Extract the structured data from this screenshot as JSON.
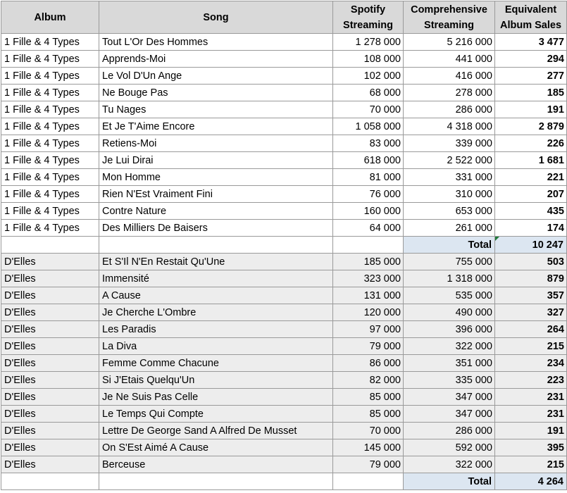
{
  "headers": {
    "album": "Album",
    "song": "Song",
    "spotify": [
      "Spotify",
      "Streaming"
    ],
    "comprehensive": [
      "Comprehensive",
      "Streaming"
    ],
    "equivalent": [
      "Equivalent",
      "Album Sales"
    ]
  },
  "groups": [
    {
      "rows": [
        {
          "album": "1 Fille & 4 Types",
          "song": "Tout L'Or Des Hommes",
          "spotify": "1 278 000",
          "comprehensive": "5 216 000",
          "eas": "3 477"
        },
        {
          "album": "1 Fille & 4 Types",
          "song": "Apprends-Moi",
          "spotify": "108 000",
          "comprehensive": "441 000",
          "eas": "294"
        },
        {
          "album": "1 Fille & 4 Types",
          "song": "Le Vol D'Un Ange",
          "spotify": "102 000",
          "comprehensive": "416 000",
          "eas": "277"
        },
        {
          "album": "1 Fille & 4 Types",
          "song": "Ne Bouge Pas",
          "spotify": "68 000",
          "comprehensive": "278 000",
          "eas": "185"
        },
        {
          "album": "1 Fille & 4 Types",
          "song": "Tu Nages",
          "spotify": "70 000",
          "comprehensive": "286 000",
          "eas": "191"
        },
        {
          "album": "1 Fille & 4 Types",
          "song": "Et Je T'Aime Encore",
          "spotify": "1 058 000",
          "comprehensive": "4 318 000",
          "eas": "2 879"
        },
        {
          "album": "1 Fille & 4 Types",
          "song": "Retiens-Moi",
          "spotify": "83 000",
          "comprehensive": "339 000",
          "eas": "226"
        },
        {
          "album": "1 Fille & 4 Types",
          "song": "Je Lui Dirai",
          "spotify": "618 000",
          "comprehensive": "2 522 000",
          "eas": "1 681"
        },
        {
          "album": "1 Fille & 4 Types",
          "song": "Mon Homme",
          "spotify": "81 000",
          "comprehensive": "331 000",
          "eas": "221"
        },
        {
          "album": "1 Fille & 4 Types",
          "song": "Rien N'Est Vraiment Fini",
          "spotify": "76 000",
          "comprehensive": "310 000",
          "eas": "207"
        },
        {
          "album": "1 Fille & 4 Types",
          "song": "Contre Nature",
          "spotify": "160 000",
          "comprehensive": "653 000",
          "eas": "435"
        },
        {
          "album": "1 Fille & 4 Types",
          "song": "Des Milliers De Baisers",
          "spotify": "64 000",
          "comprehensive": "261 000",
          "eas": "174"
        }
      ],
      "total_label": "Total",
      "total_value": "10 247"
    },
    {
      "rows": [
        {
          "album": "D'Elles",
          "song": "Et S'Il N'En Restait Qu'Une",
          "spotify": "185 000",
          "comprehensive": "755 000",
          "eas": "503"
        },
        {
          "album": "D'Elles",
          "song": "Immensité",
          "spotify": "323 000",
          "comprehensive": "1 318 000",
          "eas": "879"
        },
        {
          "album": "D'Elles",
          "song": "A Cause",
          "spotify": "131 000",
          "comprehensive": "535 000",
          "eas": "357"
        },
        {
          "album": "D'Elles",
          "song": "Je Cherche L'Ombre",
          "spotify": "120 000",
          "comprehensive": "490 000",
          "eas": "327"
        },
        {
          "album": "D'Elles",
          "song": "Les Paradis",
          "spotify": "97 000",
          "comprehensive": "396 000",
          "eas": "264"
        },
        {
          "album": "D'Elles",
          "song": "La Diva",
          "spotify": "79 000",
          "comprehensive": "322 000",
          "eas": "215"
        },
        {
          "album": "D'Elles",
          "song": "Femme Comme Chacune",
          "spotify": "86 000",
          "comprehensive": "351 000",
          "eas": "234"
        },
        {
          "album": "D'Elles",
          "song": "Si J'Etais Quelqu'Un",
          "spotify": "82 000",
          "comprehensive": "335 000",
          "eas": "223"
        },
        {
          "album": "D'Elles",
          "song": "Je Ne Suis Pas Celle",
          "spotify": "85 000",
          "comprehensive": "347 000",
          "eas": "231"
        },
        {
          "album": "D'Elles",
          "song": "Le Temps Qui Compte",
          "spotify": "85 000",
          "comprehensive": "347 000",
          "eas": "231"
        },
        {
          "album": "D'Elles",
          "song": "Lettre De George Sand A Alfred De Musset",
          "spotify": "70 000",
          "comprehensive": "286 000",
          "eas": "191"
        },
        {
          "album": "D'Elles",
          "song": "On S'Est Aimé A Cause",
          "spotify": "145 000",
          "comprehensive": "592 000",
          "eas": "395"
        },
        {
          "album": "D'Elles",
          "song": "Berceuse",
          "spotify": "79 000",
          "comprehensive": "322 000",
          "eas": "215"
        }
      ],
      "total_label": "Total",
      "total_value": "4 264"
    }
  ],
  "colors": {
    "header_bg": "#d9d9d9",
    "group2_bg": "#ededed",
    "total_bg": "#dce6f1",
    "grid": "#9a9a9a",
    "comment_marker": "#1f7a3a"
  }
}
